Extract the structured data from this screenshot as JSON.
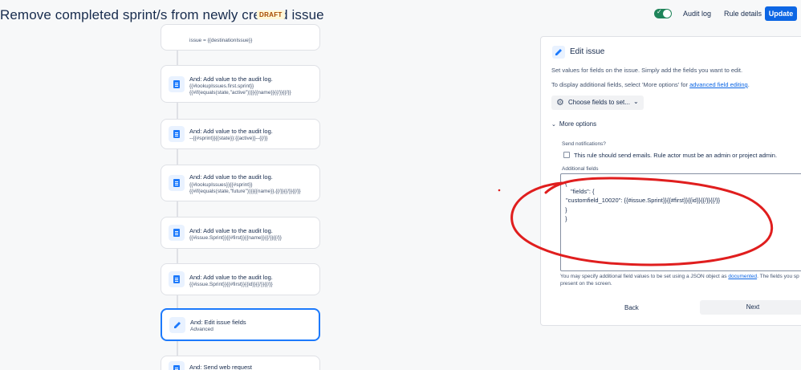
{
  "header": {
    "title": "Remove completed sprint/s from newly created issue",
    "draft": "DRAFT",
    "audit_log": "Audit log",
    "rule_details": "Rule details",
    "update": "Update",
    "toggle_on": true
  },
  "flow": {
    "top_partial_sub": "issue = {{destinationIssue}}",
    "cards": [
      {
        "title": "And: Add value to the audit log.",
        "lines": [
          "{{#lookupIssues.first.sprint}}",
          "{{#if(equals(state,\"active\"))}}{{name}}{{/}}{{/}}"
        ]
      },
      {
        "title": "And: Add value to the audit log.",
        "lines": [
          "--{{#sprint}}{{state}}:{{active}}--{{/}}"
        ]
      },
      {
        "title": "And: Add value to the audit log.",
        "lines": [
          "{{#lookupIssues}}{{#sprint}}",
          "{{#if(equals(state,\"future\"))}}{{name}},{{/}}{{/}}{{/}}"
        ]
      },
      {
        "title": "And: Add value to the audit log.",
        "lines": [
          "{{#issue.Sprint}}{{#first}}{{name}}{{/}}{{/}}"
        ]
      },
      {
        "title": "And: Add value to the audit log.",
        "lines": [
          "{{#issue.Sprint}}{{#first}}{{id}}{{/}}{{/}}"
        ]
      },
      {
        "title": "And: Edit issue fields",
        "lines": [
          "Advanced"
        ]
      },
      {
        "title": "And: Send web request",
        "lines": []
      }
    ]
  },
  "panel": {
    "title": "Edit issue",
    "desc": "Set values for fields on the issue. Simply add the fields you want to edit.",
    "display_prefix": "To display additional fields, select 'More options' for",
    "display_link": "advanced field editing",
    "display_suffix": ".",
    "choose_fields": "Choose fields to set...",
    "more_options": "More options",
    "send_notifications": "Send notifications?",
    "checkbox_label": "This rule should send emails. Rule actor must be an admin or project admin.",
    "additional_fields": "Additional fields",
    "json_lines": [
      "{",
      "\"fields\": {",
      "\"customfield_10020\": {{#issue.Sprint}}{{#first}}{{id}}{{/}}{{/}}",
      "}",
      "}"
    ],
    "help_prefix": "You may specify additional field values to be set using a JSON object as",
    "help_link": "documented",
    "help_suffix": ". The fields you sp",
    "help_line2": "present on the screen.",
    "back": "Back",
    "next": "Next"
  },
  "colors": {
    "accent": "#0c66e4",
    "selected_border": "#1d7afc",
    "annotation_red": "#e01e1e"
  }
}
